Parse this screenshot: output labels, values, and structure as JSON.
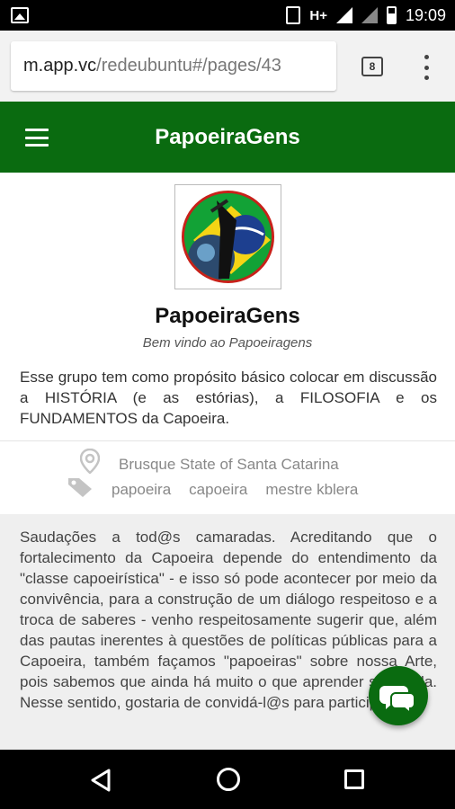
{
  "status_bar": {
    "network": "H+",
    "time": "19:09"
  },
  "browser": {
    "url_host": "m.app.vc",
    "url_path": "/redeubuntu#/pages/43",
    "tab_count": "8"
  },
  "header": {
    "title": "PapoeiraGens"
  },
  "profile": {
    "name": "PapoeiraGens",
    "subtitle": "Bem vindo ao Papoeiragens",
    "description": "Esse grupo tem como propósito básico colocar em discussão a HISTÓRIA (e as estórias), a FILOSOFIA e os FUNDAMENTOS da Capoeira."
  },
  "meta": {
    "location": "Brusque State of Santa Catarina",
    "tags": [
      "papoeira",
      "capoeira",
      "mestre kblera"
    ]
  },
  "post": {
    "text": "Saudações a tod@s camaradas. Acreditando que o fortalecimento da Capoeira depende do entendimento da \"classe capoeirística\" - e isso só pode acontecer por meio da convivência, para a construção de um diálogo respeitoso e a troca de saberes - venho respeitosamente sugerir que, além das pautas inerentes à questões de políticas públicas para a Capoeira, também façamos \"papoeiras\" sobre nossa Arte, pois sabemos que ainda há muito o que aprender sobre ela. Nesse sentido, gostaria de convidá-l@s para participar de"
  },
  "colors": {
    "brand_green": "#0a6b10",
    "logo_ring": "#c8211a"
  }
}
